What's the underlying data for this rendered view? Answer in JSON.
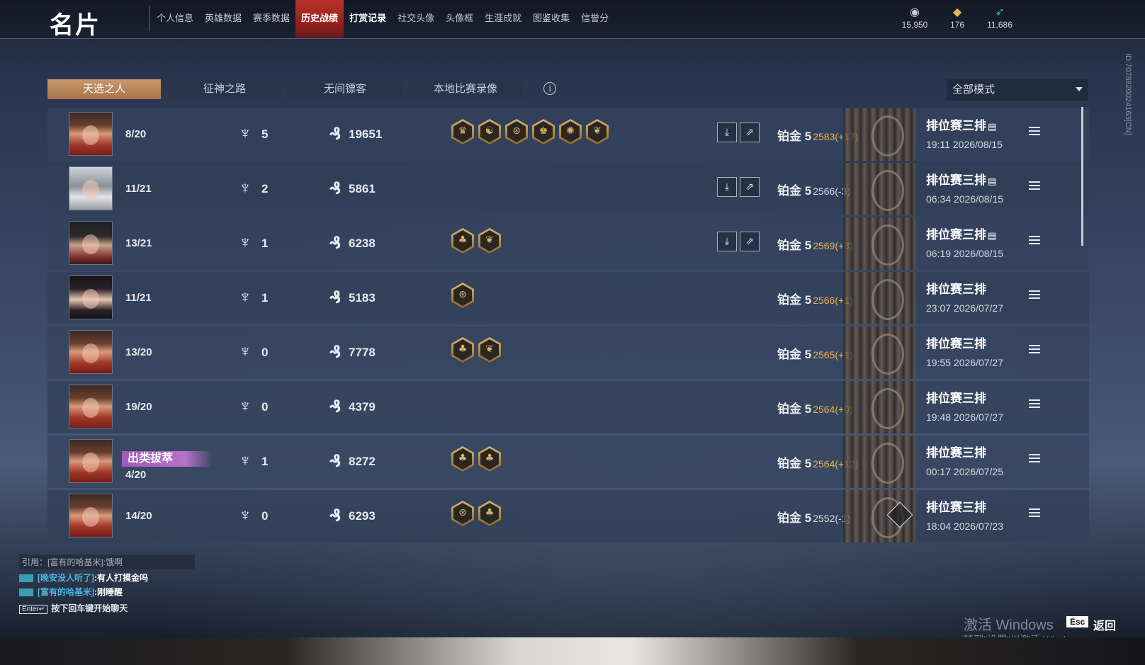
{
  "header": {
    "title": "名片",
    "nav": [
      "个人信息",
      "英雄数据",
      "赛季数据",
      "历史战绩",
      "打赏记录",
      "社交头像",
      "头像框",
      "生涯成就",
      "图鉴收集",
      "信誉分"
    ],
    "active_nav_index": 3,
    "currencies": [
      {
        "icon": "eye-coin-icon",
        "value": "15,950"
      },
      {
        "icon": "gold-coin-icon",
        "value": "176"
      },
      {
        "icon": "feather-icon",
        "value": "11,686"
      }
    ]
  },
  "tabs": [
    "天选之人",
    "征神之路",
    "无间镖客",
    "本地比赛录像"
  ],
  "active_tab_index": 0,
  "mode_select": {
    "value": "全部模式"
  },
  "matches": [
    {
      "avatar": "red",
      "placement": "8/20",
      "kills": "5",
      "damage": "19651",
      "badges": [
        "♛",
        "☯",
        "⊛",
        "♚",
        "✺",
        "❦"
      ],
      "actions": true,
      "tier": "铂金 5",
      "score": "2583(+17)",
      "gain": true,
      "mode": "排位赛三排",
      "doc": true,
      "time": "19:11 2026/08/15"
    },
    {
      "avatar": "white",
      "placement": "11/21",
      "kills": "2",
      "damage": "5861",
      "badges": [],
      "actions": true,
      "tier": "铂金 5",
      "score": "2566(-3)",
      "gain": false,
      "mode": "排位赛三排",
      "doc": true,
      "time": "06:34 2026/08/15"
    },
    {
      "avatar": "dark",
      "placement": "13/21",
      "kills": "1",
      "damage": "6238",
      "badges": [
        "♣",
        "❦"
      ],
      "actions": true,
      "tier": "铂金 5",
      "score": "2569(+3)",
      "gain": true,
      "mode": "排位赛三排",
      "doc": true,
      "time": "06:19 2026/08/15"
    },
    {
      "avatar": "girl",
      "placement": "11/21",
      "kills": "1",
      "damage": "5183",
      "badges": [
        "⊛"
      ],
      "actions": false,
      "tier": "铂金 5",
      "score": "2566(+1)",
      "gain": true,
      "mode": "排位赛三排",
      "doc": false,
      "time": "23:07 2026/07/27"
    },
    {
      "avatar": "red",
      "placement": "13/20",
      "kills": "0",
      "damage": "7778",
      "badges": [
        "♣",
        "❦"
      ],
      "actions": false,
      "tier": "铂金 5",
      "score": "2565(+1)",
      "gain": true,
      "mode": "排位赛三排",
      "doc": false,
      "time": "19:55 2026/07/27"
    },
    {
      "avatar": "red",
      "placement": "19/20",
      "kills": "0",
      "damage": "4379",
      "badges": [],
      "actions": false,
      "tier": "铂金 5",
      "score": "2564(+0)",
      "gain": true,
      "mode": "排位赛三排",
      "doc": false,
      "time": "19:48 2026/07/27"
    },
    {
      "avatar": "red",
      "placement": "4/20",
      "rank_tag": "出类拔萃",
      "kills": "1",
      "damage": "8272",
      "badges": [
        "♣",
        "♣"
      ],
      "actions": false,
      "tier": "铂金 5",
      "score": "2564(+12)",
      "gain": true,
      "mode": "排位赛三排",
      "doc": false,
      "time": "00:17 2026/07/25"
    },
    {
      "avatar": "red",
      "placement": "14/20",
      "kills": "0",
      "damage": "6293",
      "badges": [
        "⊛",
        "♣"
      ],
      "actions": false,
      "tier": "铂金 5",
      "score": "2552(-1)",
      "gain": false,
      "mode": "排位赛三排",
      "doc": false,
      "time": "18:04 2026/07/23",
      "flag": true
    }
  ],
  "chat": {
    "quote": "引用：[富有的哈基米]:饿啊",
    "lines": [
      {
        "nick": "[晚安没人听了]",
        "text": ":有人打摸金吗"
      },
      {
        "nick": "[富有的哈基米]",
        "text": ":刚睡醒"
      }
    ],
    "hint_key": "Enter↵",
    "hint": "按下回车键开始聊天"
  },
  "watermark": {
    "title": "激活 Windows",
    "sub": "转到\"设置\"以激活 Windows。"
  },
  "esc": {
    "key": "Esc",
    "label": "返回"
  },
  "side_id": "ID:7078820024163[CN]"
}
